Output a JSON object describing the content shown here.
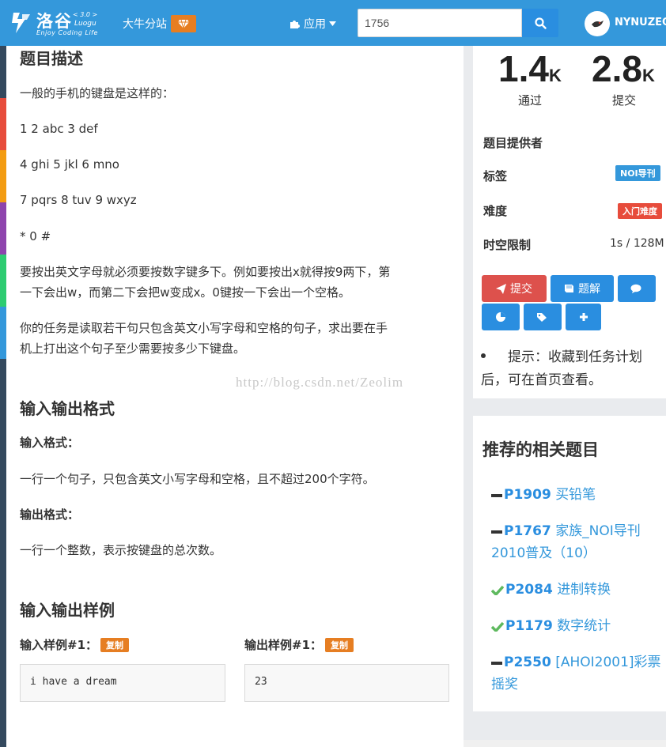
{
  "header": {
    "logo_text": "洛谷",
    "logo_version": "< 3.0 >",
    "logo_en": "Luogu",
    "logo_tagline": "Enjoy Coding Life",
    "branch_label": "大牛分站",
    "apps_label": "应用",
    "search_value": "1756",
    "username": "NYNUZEO"
  },
  "problem": {
    "desc_title": "题目描述",
    "desc_lines": [
      "一般的手机的键盘是这样的：",
      "1 2 abc 3 def",
      "4 ghi 5 jkl 6 mno",
      "7 pqrs 8 tuv 9 wxyz",
      "* 0 #"
    ],
    "para1_line1": "要按出英文字母就必须要按数字键多下。例如要按出x就得按9两下，第",
    "para1_line2": "一下会出w，而第二下会把w变成x。0键按一下会出一个空格。",
    "para2_line1": "你的任务是读取若干句只包含英文小写字母和空格的句子，求出要在手",
    "para2_line2": "机上打出这个句子至少需要按多少下键盘。",
    "io_title": "输入输出格式",
    "input_format_label": "输入格式：",
    "input_format_text": "一行一个句子，只包含英文小写字母和空格，且不超过200个字符。",
    "output_format_label": "输出格式：",
    "output_format_text": "一行一个整数，表示按键盘的总次数。",
    "samples_title": "输入输出样例",
    "input_sample_label": "输入样例#1：",
    "output_sample_label": "输出样例#1：",
    "copy_label": "复制",
    "input_sample": "i have a dream",
    "output_sample": "23",
    "watermark": "http://blog.csdn.net/Zeolim"
  },
  "stats": {
    "passed_num": "1.4",
    "passed_unit": "K",
    "passed_label": "通过",
    "submitted_num": "2.8",
    "submitted_unit": "K",
    "submitted_label": "提交"
  },
  "info": {
    "provider_label": "题目提供者",
    "tags_label": "标签",
    "tag_value": "NOI导刊",
    "difficulty_label": "难度",
    "difficulty_value": "入门难度",
    "limit_label": "时空限制",
    "limit_value": "1s / 128M"
  },
  "actions": {
    "submit_label": "提交",
    "solution_label": "题解"
  },
  "hint": {
    "text": "提示：收藏到任务计划后，可在首页查看。"
  },
  "recommend": {
    "title": "推荐的相关题目",
    "items": [
      {
        "pid": "P1909",
        "title": "买铅笔",
        "status": "dash"
      },
      {
        "pid": "P1767",
        "title": "家族_NOI导刊2010普及（10）",
        "status": "dash"
      },
      {
        "pid": "P2084",
        "title": "进制转换",
        "status": "check"
      },
      {
        "pid": "P1179",
        "title": "数字统计",
        "status": "check"
      },
      {
        "pid": "P2550",
        "title": "[AHOI2001]彩票摇奖",
        "status": "dash"
      }
    ]
  },
  "colors": {
    "navbar": "#3498db",
    "orange": "#e67e22",
    "red": "#e74c3c",
    "blue": "#3498db",
    "green": "#5eb95e"
  }
}
